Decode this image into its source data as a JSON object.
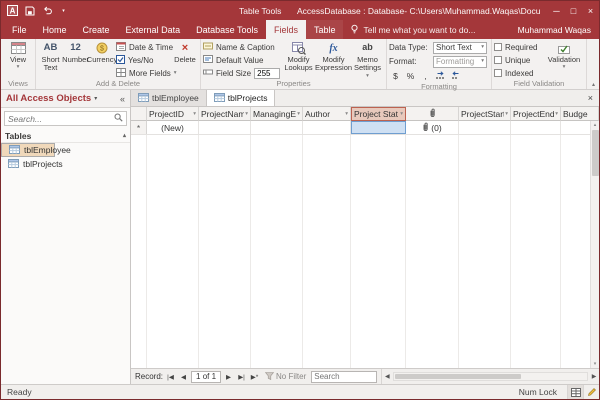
{
  "colors": {
    "brand": "#A4373A",
    "sidebar_selection": "#F0D8BA",
    "selected_column_header": "#E8C9BC",
    "selected_cell": "#CFE0F3"
  },
  "icons": {
    "minimize": "─",
    "maximize": "□",
    "close": "×",
    "dropdown": "▾",
    "pane_dropdown": "▾",
    "pane_collapse": "«",
    "section_collapse": "▴",
    "ribbon_collapse": "▴",
    "tab_close": "×",
    "scroll_up": "▴",
    "scroll_down": "▾",
    "scroll_left": "◀",
    "scroll_right": "▶"
  },
  "titlebar": {
    "contextual_tab_group": "Table Tools",
    "title": "AccessDatabase : Database- C:\\Users\\Muhammad.Waqas\\Docum...",
    "user": "Muhammad Waqas"
  },
  "ribbon_tabs": [
    "File",
    "Home",
    "Create",
    "External Data",
    "Database Tools",
    "Fields",
    "Table"
  ],
  "tellme": "Tell me what you want to do...",
  "ribbon": {
    "views": {
      "view": "View",
      "label": "Views"
    },
    "add_delete": {
      "short_text_icon": "AB",
      "short_text": "Short Text",
      "number_icon": "12",
      "number": "Number",
      "currency": "Currency",
      "date_time": "Date & Time",
      "yes_no": "Yes/No",
      "more_fields": "More Fields",
      "delete": "Delete",
      "delete_icon": "×",
      "label": "Add & Delete"
    },
    "properties": {
      "name_caption": "Name & Caption",
      "default_value": "Default Value",
      "field_size": "Field Size",
      "field_size_value": "255",
      "modify_lookups": "Modify Lookups",
      "modify_expression": "Modify Expression",
      "memo_settings": "Memo Settings",
      "fx_icon": "fx",
      "ab_icon": "ab",
      "label": "Properties"
    },
    "formatting": {
      "data_type": "Data Type:",
      "data_type_value": "Short Text",
      "format": "Format:",
      "format_value": "Formatting",
      "currency_symbol": "$",
      "percent_symbol": "%",
      "comma_symbol": ",",
      "label": "Formatting"
    },
    "field_validation": {
      "required": "Required",
      "unique": "Unique",
      "indexed": "Indexed",
      "validation": "Validation",
      "label": "Field Validation"
    }
  },
  "sidebar": {
    "title": "All Access Objects",
    "search_placeholder": "Search...",
    "section": "Tables",
    "items": [
      "tblEmployee",
      "tblProjects"
    ]
  },
  "doc_tabs": [
    "tblEmployee",
    "tblProjects"
  ],
  "datasheet": {
    "columns": [
      "ProjectID",
      "ProjectNam",
      "ManagingEd",
      "Author",
      "Project Stat",
      "ProjectStart",
      "ProjectEnd",
      "Budge"
    ],
    "new_row": {
      "selector": "*",
      "id": "(New)",
      "attachment_count": "(0)"
    }
  },
  "record_nav": {
    "label": "Record:",
    "first": "|◀",
    "prev": "◀",
    "position": "1 of 1",
    "next": "▶",
    "last": "▶|",
    "new_record": "▶*",
    "no_filter": "No Filter",
    "search_placeholder": "Search"
  },
  "statusbar": {
    "ready": "Ready",
    "num_lock": "Num Lock"
  }
}
